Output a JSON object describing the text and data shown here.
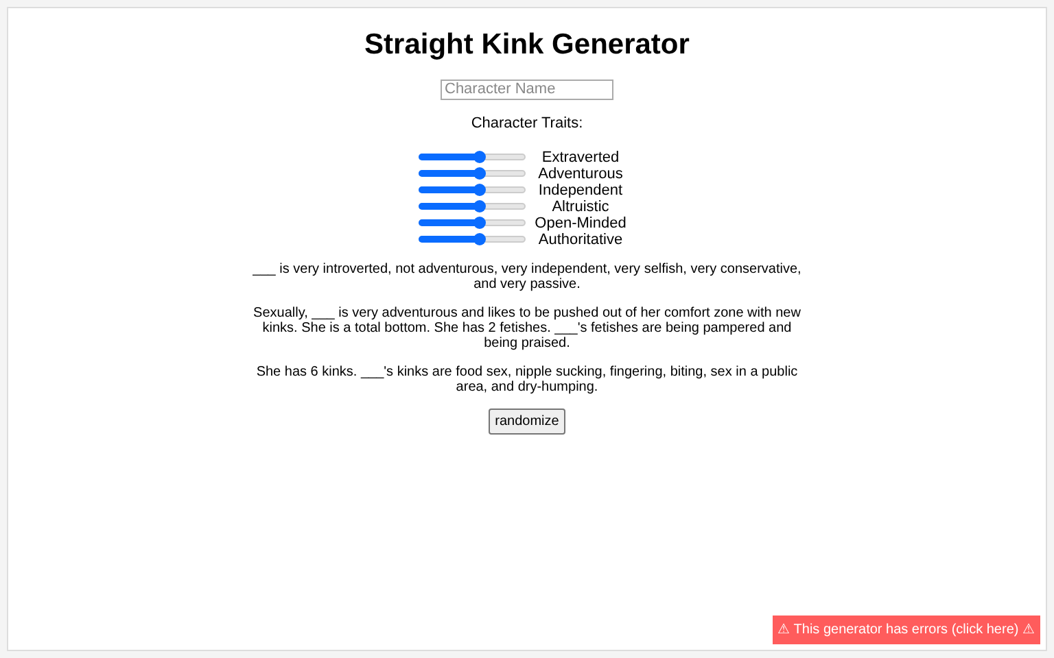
{
  "title": "Straight Kink Generator",
  "name_field": {
    "placeholder": "Character Name"
  },
  "traits_heading": "Character Traits:",
  "traits": [
    {
      "label": "Extraverted",
      "level": 0.56
    },
    {
      "label": "Adventurous",
      "level": 0.56
    },
    {
      "label": "Independent",
      "level": 0.56
    },
    {
      "label": "Altruistic",
      "level": 0.56
    },
    {
      "label": "Open-Minded",
      "level": 0.56
    },
    {
      "label": "Authoritative",
      "level": 0.56
    }
  ],
  "paragraphs": [
    "___ is very introverted, not adventurous, very independent, very selfish, very conservative, and very passive.",
    "Sexually, ___ is very adventurous and likes to be pushed out of her comfort zone with new kinks. She is a total bottom. She has 2 fetishes. ___'s fetishes are being pampered and being praised.",
    "She has 6 kinks. ___'s kinks are food sex, nipple sucking, fingering, biting, sex in a public area, and dry-humping."
  ],
  "randomize_button": "randomize",
  "error_banner": "⚠ This generator has errors (click here) ⚠"
}
